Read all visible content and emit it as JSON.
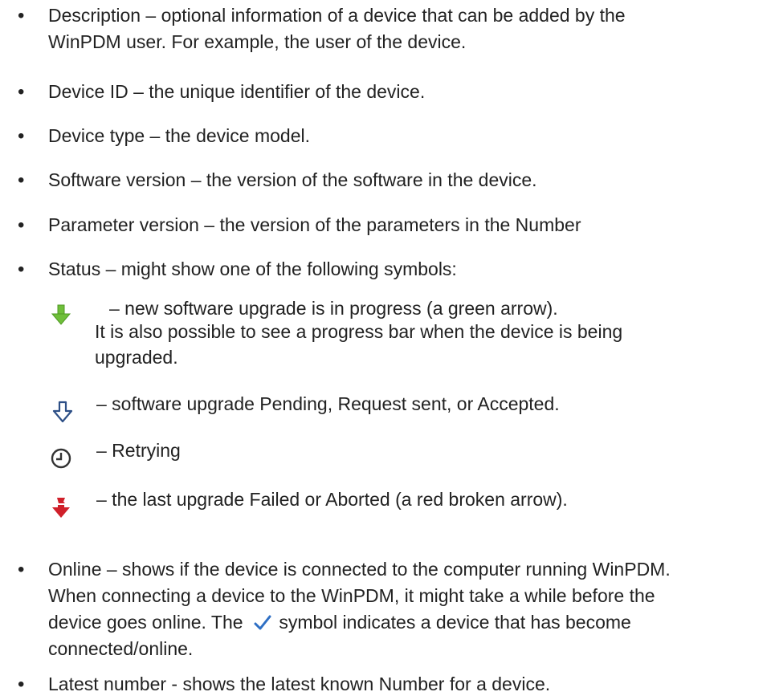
{
  "bullets": {
    "description": {
      "line1": "Description – optional information of a device that can be added by the",
      "line2": "WinPDM user. For example, the user of the device."
    },
    "device_id": "Device ID – the unique identifier of the device.",
    "device_type": "Device type – the device model.",
    "software_version": "Software version – the version of the software in the device.",
    "parameter_version": "Parameter version – the version of the parameters in the Number",
    "status": "Status – might show one of the following symbols:",
    "online": {
      "line1": "Online – shows if the device is connected to the computer running WinPDM.",
      "line2": "When connecting a device to the WinPDM, it might take a while before the",
      "line3_before": "device goes online. The",
      "line3_after": "symbol indicates a device that has become",
      "line4": "connected/online.",
      "icon": "checkmark-icon"
    },
    "latest_number": "Latest number - shows the latest known Number for a device."
  },
  "status_symbols": [
    {
      "icon": "green-down-arrow-icon",
      "line1": "– new software upgrade is in progress (a green arrow).",
      "line2": "It is also possible to see a progress bar when the device is being",
      "line3": "upgraded."
    },
    {
      "icon": "outline-down-arrow-icon",
      "line1": "– software upgrade Pending, Request sent, or Accepted."
    },
    {
      "icon": "clock-icon",
      "line1": "– Retrying"
    },
    {
      "icon": "red-broken-arrow-icon",
      "line1": "– the last upgrade Failed or Aborted (a red broken arrow)."
    }
  ],
  "bullet_glyph": "•",
  "colors": {
    "text": "#222222",
    "green_arrow": "#6fbf3a",
    "outline_arrow": "#2d4f86",
    "red_arrow": "#d0202a",
    "checkmark": "#2e6fc4"
  }
}
